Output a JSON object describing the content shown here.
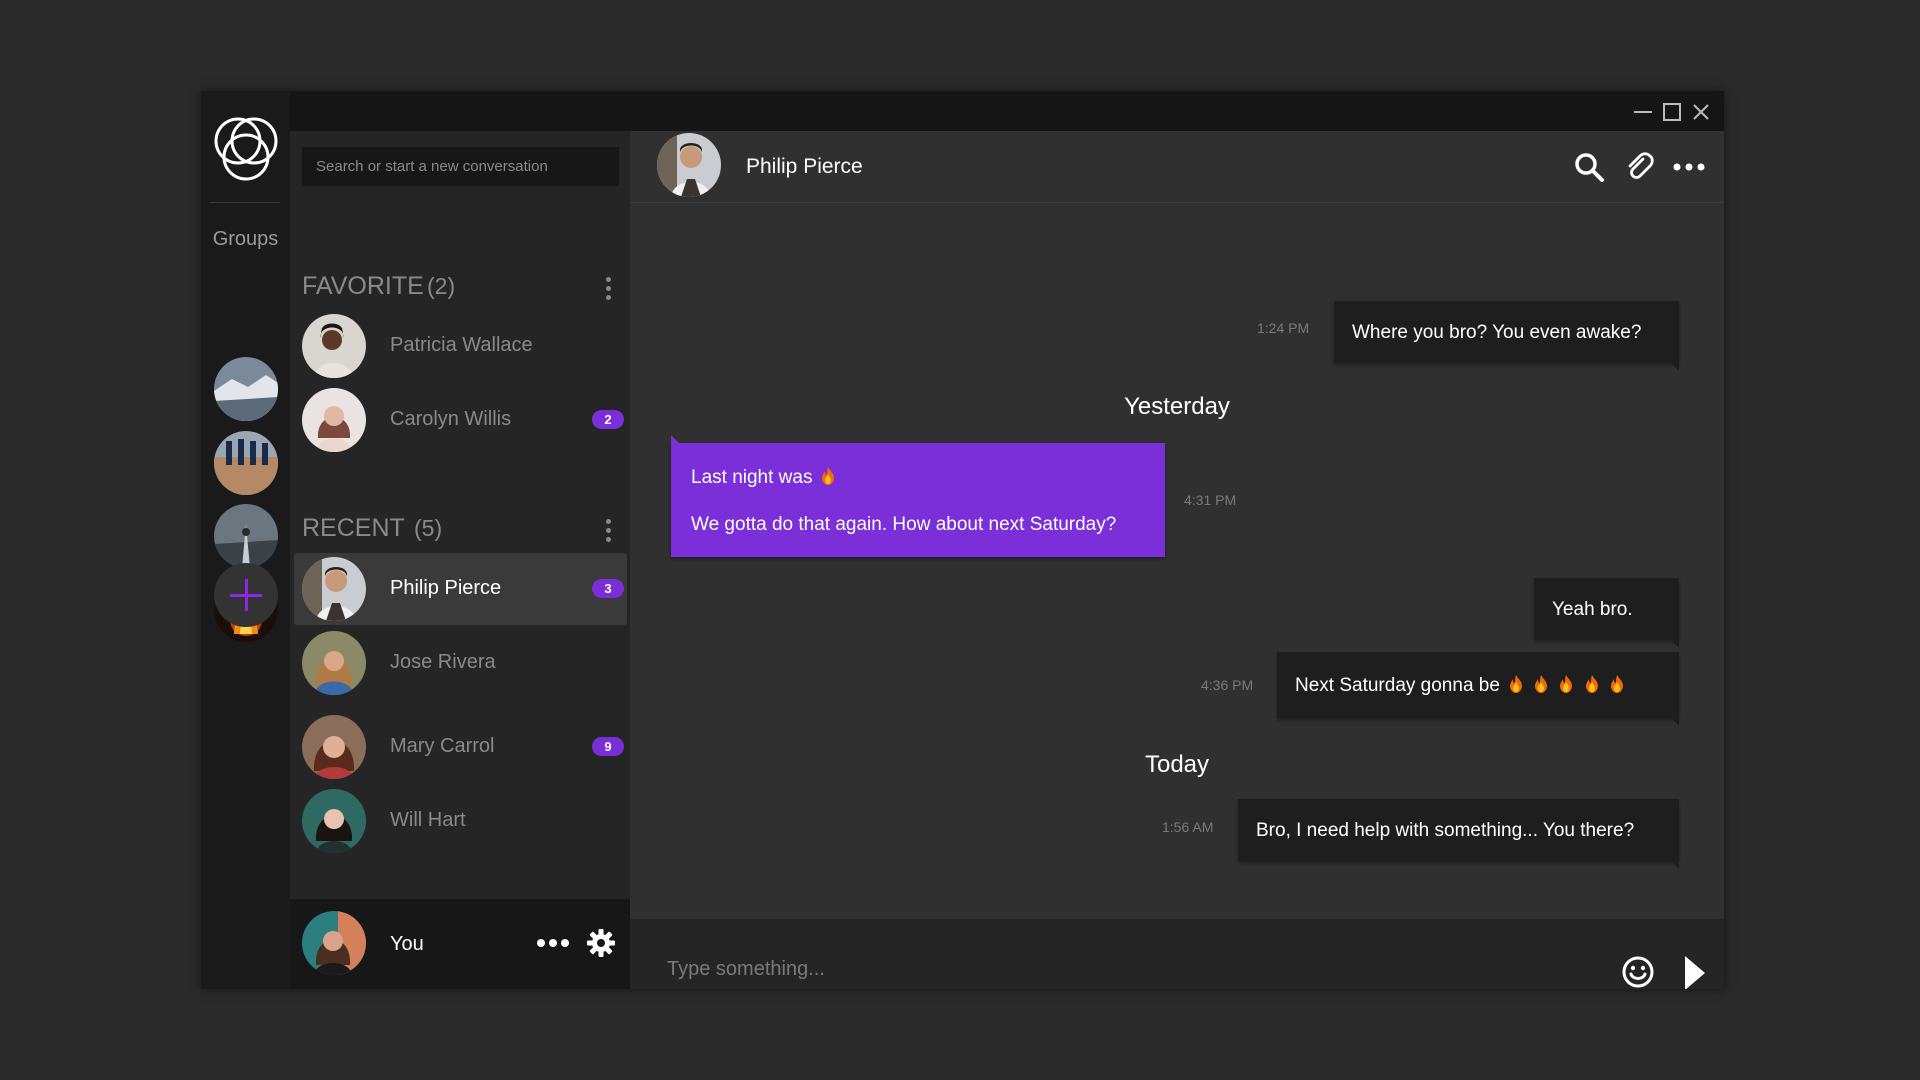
{
  "window": {
    "controls": [
      "minimize-icon",
      "maximize-icon",
      "close-icon"
    ]
  },
  "rail": {
    "groups_label": "Groups",
    "groups": [
      "group-avatar",
      "group-avatar",
      "group-avatar",
      "group-avatar"
    ],
    "add_icon": "plus-icon"
  },
  "sidebar": {
    "search_placeholder": "Search or start a new conversation",
    "favorite": {
      "title": "FAVORITE",
      "count": "(2)",
      "contacts": [
        {
          "name": "Patricia Wallace",
          "badge": ""
        },
        {
          "name": "Carolyn Willis",
          "badge": "2"
        }
      ]
    },
    "recent": {
      "title": "RECENT",
      "count": "(5)",
      "contacts": [
        {
          "name": "Philip Pierce",
          "badge": "3",
          "active": true
        },
        {
          "name": "Jose Rivera",
          "badge": ""
        },
        {
          "name": "Mary Carrol",
          "badge": "9"
        },
        {
          "name": "Will Hart",
          "badge": ""
        }
      ]
    },
    "me": {
      "name": "You"
    }
  },
  "chat": {
    "contact_name": "Philip Pierce",
    "header_icons": [
      "search-icon",
      "paperclip-icon",
      "more-icon"
    ],
    "messages": [
      {
        "direction": "out",
        "time": "1:24 PM",
        "text": "Where you bro? You even awake?"
      },
      {
        "day": "Yesterday"
      },
      {
        "direction": "in",
        "time": "4:31 PM",
        "lines": [
          "Last night was",
          "We gotta do that again. How about next Saturday?"
        ],
        "emoji": "fire"
      },
      {
        "direction": "out",
        "time": "",
        "text": "Yeah bro."
      },
      {
        "direction": "out",
        "time": "4:36 PM",
        "text": "Next Saturday gonna be",
        "emoji": "fire x5"
      },
      {
        "day": "Today"
      },
      {
        "direction": "out",
        "time": "1:56 AM",
        "text": "Bro, I need help with something... You there?"
      }
    ],
    "composer_placeholder": "Type something...",
    "composer_icons": [
      "emoji-icon",
      "send-icon"
    ]
  },
  "colors": {
    "accent": "#7b2fd9",
    "badge": "#7a2ed8",
    "background": "#2a2a2a",
    "chat_bg": "#303030",
    "panel_bg": "#252525",
    "bubble_out": "#1e1e1e"
  }
}
